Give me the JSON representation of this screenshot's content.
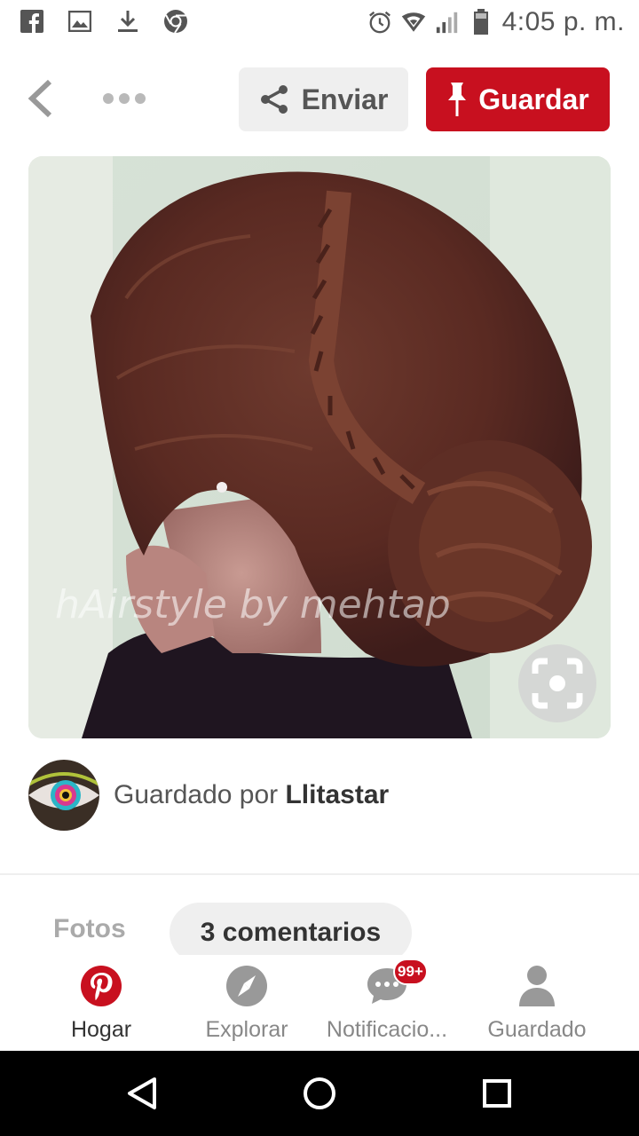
{
  "status_bar": {
    "time": "4:05 p. m.",
    "left_icons": [
      "facebook-icon",
      "image-icon",
      "download-icon",
      "chrome-icon"
    ],
    "right_icons": [
      "alarm-icon",
      "wifi-icon",
      "signal-icon",
      "battery-icon"
    ]
  },
  "action_bar": {
    "send_label": "Enviar",
    "save_label": "Guardar"
  },
  "pin": {
    "watermark": "hAirstyle by mehtap"
  },
  "saved_by": {
    "prefix": "Guardado por",
    "user": "Llitastar"
  },
  "tabs": {
    "photos": "Fotos",
    "comments": "3 comentarios"
  },
  "bottom_nav": {
    "items": [
      {
        "label": "Hogar",
        "icon": "pinterest-icon"
      },
      {
        "label": "Explorar",
        "icon": "compass-icon"
      },
      {
        "label": "Notificacio...",
        "icon": "chat-icon",
        "badge": "99+"
      },
      {
        "label": "Guardado",
        "icon": "person-icon"
      }
    ]
  },
  "colors": {
    "brand_red": "#c8101f",
    "button_gray": "#efefef"
  }
}
